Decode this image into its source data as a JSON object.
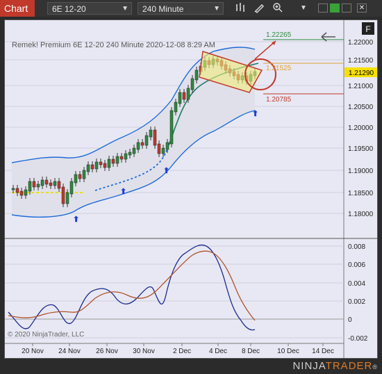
{
  "window": {
    "title": "Chart",
    "instrument": "6E 12-20",
    "interval": "240 Minute"
  },
  "toolbar": {
    "icons": [
      "bar-style-icon",
      "drawing-tool-icon",
      "zoom-icon",
      "dropdown-icon"
    ],
    "window_buttons": [
      "minimize",
      "maximize",
      "close"
    ]
  },
  "chart": {
    "header": "Remek!  Premium  6E 12-20  240 Minute  2020-12-08 8:29 AM",
    "f_button": "F",
    "copyright": "© 2020 NinjaTrader, LLC",
    "price_axis": [
      "1.22000",
      "1.21500",
      "1.21000",
      "1.20500",
      "1.20000",
      "1.19500",
      "1.19000",
      "1.18500",
      "1.18000"
    ],
    "last_price": "1.21290",
    "target_price": "1.22265",
    "stop_price": "1.20785",
    "mid_level": "1.21525",
    "osc_axis": [
      "0.008",
      "0.006",
      "0.004",
      "0.002",
      "0",
      "-0.002"
    ],
    "x_axis": [
      "20 Nov",
      "24 Nov",
      "26 Nov",
      "30 Nov",
      "2 Dec",
      "4 Dec",
      "8 Dec",
      "10 Dec",
      "14 Dec"
    ],
    "colors": {
      "background": "#e8e8f4",
      "band": "#1e6bd6",
      "up_candle": "#2d8a3e",
      "down_candle": "#c0392b",
      "target": "#2d8a3e",
      "stop": "#c0392b",
      "last_price_marker": "#f5e000",
      "macd": "#1a2a8a",
      "signal": "#b0522a"
    }
  },
  "footer": {
    "brand_ninja": "NINJA",
    "brand_trader": "TRADER",
    "brand_mark": "®"
  }
}
